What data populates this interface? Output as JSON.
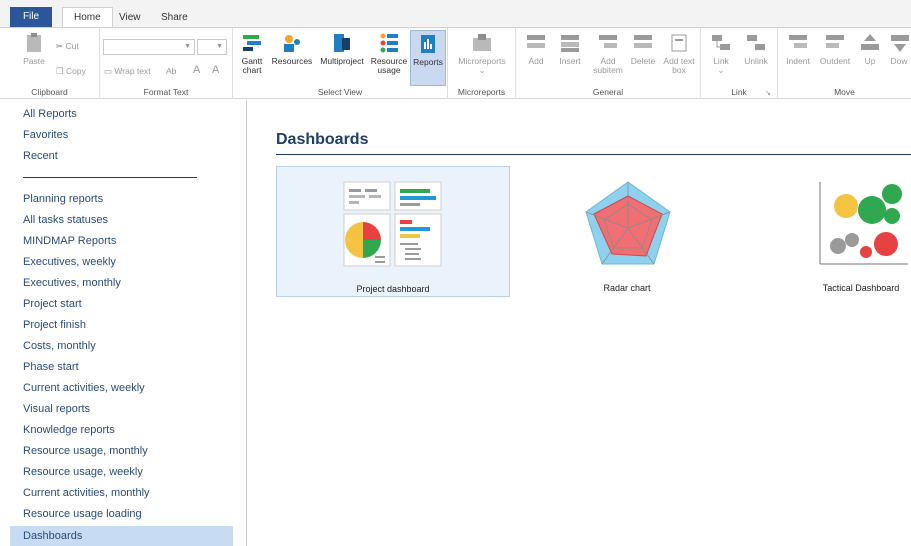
{
  "tabs": {
    "file": "File",
    "home": "Home",
    "view": "View",
    "share": "Share"
  },
  "ribbon": {
    "clipboard": {
      "paste": "Paste",
      "cut": "Cut",
      "copy": "Copy",
      "label": "Clipboard"
    },
    "format_text": {
      "wrap_text": "Wrap text",
      "ab": "Ab",
      "grow": "A",
      "shrink": "A",
      "label": "Format Text"
    },
    "select_view": {
      "gantt_line1": "Gantt",
      "gantt_line2": "chart",
      "resources": "Resources",
      "multiproject": "Multiproject",
      "res_usage_line1": "Resource",
      "res_usage_line2": "usage",
      "reports": "Reports",
      "label": "Select View"
    },
    "microreports": {
      "button": "Microreports",
      "label": "Microreports"
    },
    "general": {
      "add": "Add",
      "insert": "Insert",
      "add_subitem_line1": "Add",
      "add_subitem_line2": "subitem",
      "delete": "Delete",
      "add_textbox_line1": "Add text",
      "add_textbox_line2": "box",
      "label": "General"
    },
    "link": {
      "link": "Link",
      "unlink": "Unlink",
      "label": "Link"
    },
    "move": {
      "indent": "Indent",
      "outdent": "Outdent",
      "up": "Up",
      "down": "Dow",
      "label": "Move"
    }
  },
  "sidebar": {
    "top_items": [
      "All Reports",
      "Favorites",
      "Recent"
    ],
    "items": [
      "Planning reports",
      "All tasks statuses",
      "MINDMAP Reports",
      "Executives, weekly",
      "Executives, monthly",
      "Project start",
      "Project finish",
      "Costs, monthly",
      "Phase start",
      "Current activities, weekly",
      "Visual reports",
      "Knowledge reports",
      "Resource usage, monthly",
      "Resource usage, weekly",
      "Current activities, monthly",
      "Resource usage loading",
      "Dashboards"
    ],
    "active": "Dashboards"
  },
  "main": {
    "title": "Dashboards",
    "cards": [
      "Project dashboard",
      "Radar chart",
      "Tactical Dashboard"
    ]
  },
  "colors": {
    "file_tab": "#2b579a",
    "accent": "#1f3f66",
    "selected": "#c7dbf2"
  }
}
